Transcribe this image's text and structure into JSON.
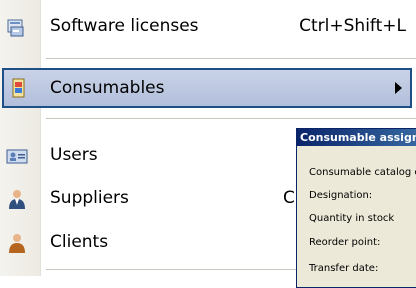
{
  "menu": {
    "items": [
      {
        "label": "Software licenses",
        "shortcut": "Ctrl+Shift+L",
        "icon": "software-licenses-icon"
      },
      {
        "label": "Consumables",
        "shortcut": "",
        "icon": "consumables-icon",
        "submenu": true,
        "highlighted": true
      },
      {
        "label": "Users",
        "shortcut": "",
        "icon": "users-icon"
      },
      {
        "label": "Suppliers",
        "shortcut": "C",
        "icon": "suppliers-icon"
      },
      {
        "label": "Clients",
        "shortcut": "",
        "icon": "clients-icon"
      }
    ]
  },
  "dialog": {
    "title": "Consumable assignme",
    "fields": [
      "Consumable catalog cod",
      "Designation:",
      "Quantity in stock",
      "Reorder point:",
      "Transfer date:"
    ]
  },
  "colors": {
    "highlight_border": "#1e4f86",
    "highlight_fill": "#b2bfdc",
    "dialog_title": "#0a246a"
  }
}
